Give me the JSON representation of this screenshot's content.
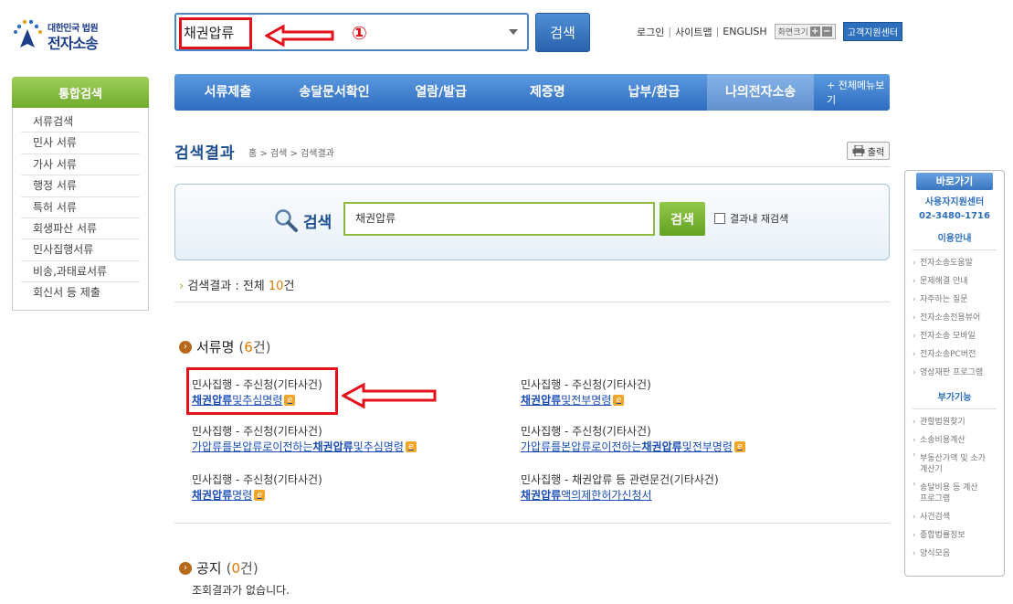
{
  "logo": {
    "org": "대한민국 법원",
    "title": "전자소송"
  },
  "top_search": {
    "value": "채권압류",
    "button": "검색"
  },
  "annotations": {
    "marker_1": "①"
  },
  "utils": {
    "login": "로그인",
    "sitemap": "사이트맵",
    "english": "ENGLISH",
    "zoom_label": "화면크기",
    "zoom_in": "+",
    "zoom_out": "−",
    "help": "고객지원센터"
  },
  "gnb": {
    "items": [
      "서류제출",
      "송달문서확인",
      "열람/발급",
      "제증명",
      "납부/환급",
      "나의전자소송"
    ],
    "all_menu": "+ 전체메뉴보기",
    "active_index": 5
  },
  "left_nav": {
    "title": "통합검색",
    "items": [
      "서류검색",
      "민사 서류",
      "가사 서류",
      "행정 서류",
      "특허 서류",
      "회생파산 서류",
      "민사집행서류",
      "비송,과태료서류",
      "회신서 등 제출"
    ]
  },
  "page": {
    "title": "검색결과",
    "breadcrumb": "홈 > 검색 > 검색결과",
    "print": "출력"
  },
  "search_box": {
    "label": "검색",
    "value": "채권압류",
    "button": "검색",
    "checkbox_label": "결과내 재검색"
  },
  "result_total": {
    "prefix": "검색결과 : 전체 ",
    "count": "10",
    "suffix": "건"
  },
  "sections": {
    "docs": {
      "title": "서류명",
      "open": " (",
      "count": "6",
      "close": "건)"
    },
    "notice": {
      "title": "공지",
      "open": " (",
      "count": "0",
      "close": "건)",
      "empty": "조회결과가 없습니다."
    }
  },
  "results": [
    {
      "sub": "민사집행 - 주신청(기타사건)",
      "pre": "",
      "kw": "채권압류",
      "post": "및추심명령",
      "ie": "e"
    },
    {
      "sub": "민사집행 - 주신청(기타사건)",
      "pre": "",
      "kw": "채권압류",
      "post": "및전부명령",
      "ie": "e"
    },
    {
      "sub": "민사집행 - 주신청(기타사건)",
      "pre": "가압류를본압류로이전하는",
      "kw": "채권압류",
      "post": "및추심명령",
      "ie": "e"
    },
    {
      "sub": "민사집행 - 주신청(기타사건)",
      "pre": "가압류를본압류로이전하는",
      "kw": "채권압류",
      "post": "및전부명령",
      "ie": "e"
    },
    {
      "sub": "민사집행 - 주신청(기타사건)",
      "pre": "",
      "kw": "채권압류",
      "post": "명령",
      "ie": "e"
    },
    {
      "sub": "민사집행 - 채권압류 등 관련문건(기타사건)",
      "pre": "",
      "kw": "채권압류",
      "post": "액의제한허가신청서",
      "ie": ""
    }
  ],
  "quick": {
    "title": "바로가기",
    "center_name": "사용자지원센터",
    "center_phone": "02-3480-1716",
    "guide_title": "이용안내",
    "guide_items": [
      "전자소송도움말",
      "문제해결 안내",
      "자주하는 질문",
      "전자소송전용뷰어",
      "전자소송 모바일",
      "전자소송PC버전",
      "영상재판 프로그램"
    ],
    "extra_title": "부가기능",
    "extra_items": [
      "관할법원찾기",
      "소송비용계산",
      "부동산가액 및 소가계산기",
      "송달비용 등 계산 프로그램",
      "사건검색",
      "종합법률정보",
      "양식모음"
    ]
  }
}
